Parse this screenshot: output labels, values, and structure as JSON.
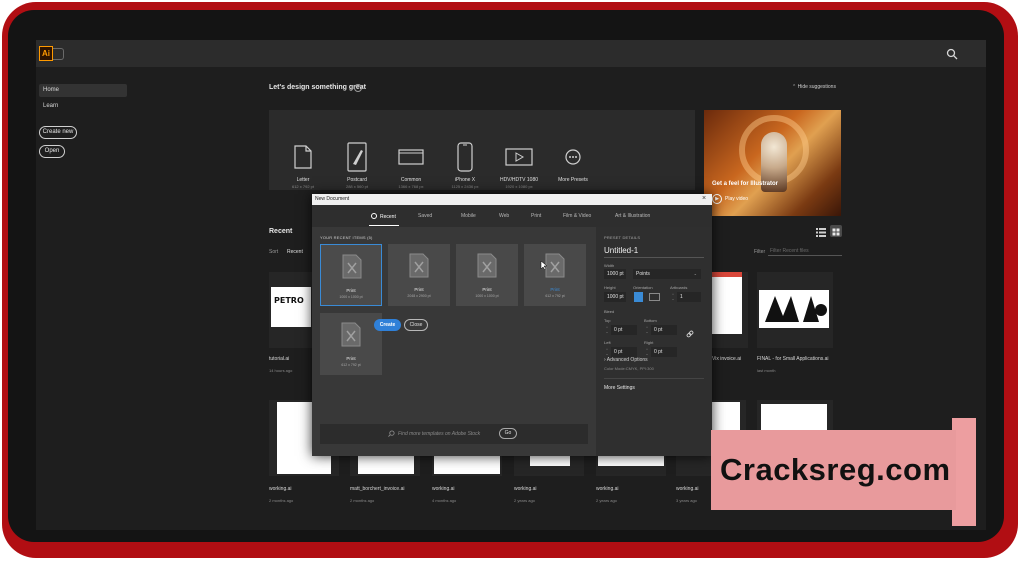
{
  "app": {
    "logo": "Ai"
  },
  "sidebar": {
    "items": [
      {
        "label": "Home"
      },
      {
        "label": "Learn"
      }
    ],
    "create_new": "Create new",
    "open": "Open"
  },
  "main": {
    "heading": "Let's design something great",
    "hide_suggestions": "Hide suggestions",
    "presets": [
      {
        "label": "Letter",
        "size": "612 x 792 pt"
      },
      {
        "label": "Postcard",
        "size": "288 x 560 pt"
      },
      {
        "label": "Common",
        "size": "1366 x 768 px"
      },
      {
        "label": "iPhone X",
        "size": "1125 x 2436 px"
      },
      {
        "label": "HDV/HDTV 1080",
        "size": "1920 x 1080 px"
      },
      {
        "label": "More Presets",
        "size": ""
      }
    ],
    "promo": {
      "title": "Get a feel for Illustrator",
      "play": "Play video"
    }
  },
  "recent": {
    "heading": "Recent",
    "sort_label": "Sort",
    "sort_value": "Recent",
    "filter_label": "Filter",
    "filter_placeholder": "Filter Recent files",
    "row1": [
      {
        "name": "tutorial.ai",
        "date": "14 hours ago"
      },
      {
        "name": "Vix invoice.ai",
        "date": ""
      },
      {
        "name": "FINAL - for Small Applications.ai",
        "date": "last month"
      }
    ],
    "row2": [
      {
        "name": "working.ai",
        "date": "2 months ago"
      },
      {
        "name": "matt_borchert_invoice.ai",
        "date": "2 months ago"
      },
      {
        "name": "working.ai",
        "date": "4 months ago"
      },
      {
        "name": "working.ai",
        "date": "2 years ago"
      },
      {
        "name": "working.ai",
        "date": "2 years ago"
      },
      {
        "name": "working.ai",
        "date": "3 years ago"
      }
    ],
    "thumb_text": "PETRO"
  },
  "dialog": {
    "title": "New Document",
    "tabs": [
      {
        "label": "Recent"
      },
      {
        "label": "Saved"
      },
      {
        "label": "Mobile"
      },
      {
        "label": "Web"
      },
      {
        "label": "Print"
      },
      {
        "label": "Film & Video"
      },
      {
        "label": "Art & Illustration"
      }
    ],
    "recent_items_label": "YOUR RECENT ITEMS",
    "recent_items_count": "(5)",
    "cards": [
      {
        "name": "Print",
        "size": "1000 x 1000 pt"
      },
      {
        "name": "Print",
        "size": "2048 x 2900 pt"
      },
      {
        "name": "Print",
        "size": "1000 x 1000 pt"
      },
      {
        "name": "Print",
        "size": "612 x 792 pt"
      },
      {
        "name": "Print",
        "size": "612 x 792 pt"
      }
    ],
    "stock_placeholder": "Find more templates on Adobe Stock",
    "go": "Go",
    "preset_details": {
      "heading": "PRESET DETAILS",
      "name": "Untitled-1",
      "width_label": "Width",
      "width": "1000 pt",
      "units": "Points",
      "height_label": "Height",
      "height": "1000 pt",
      "orientation_label": "Orientation",
      "artboards_label": "Artboards",
      "artboards": "1",
      "bleed_label": "Bleed",
      "top_label": "Top",
      "top": "0 pt",
      "bottom_label": "Bottom",
      "bottom": "0 pt",
      "left_label": "Left",
      "left": "0 pt",
      "right_label": "Right",
      "right": "0 pt",
      "advanced": "Advanced Options",
      "color_mode": "Color Mode:CMYK, PPI:300",
      "more_settings": "More Settings"
    },
    "create": "Create",
    "close": "Close"
  },
  "watermark": {
    "text": "Cracksreg.com"
  },
  "colors": {
    "frame": "#b10e13",
    "app_bg": "#1e1e1e",
    "accent_blue": "#2f80d8",
    "ai_orange": "#ff9a00",
    "watermark_bg": "#e89a9c"
  },
  "icons": [
    "search-icon",
    "info-icon",
    "chevron-up-icon",
    "list-view-icon",
    "grid-view-icon",
    "play-icon",
    "clock-icon",
    "link-icon",
    "close-icon"
  ]
}
